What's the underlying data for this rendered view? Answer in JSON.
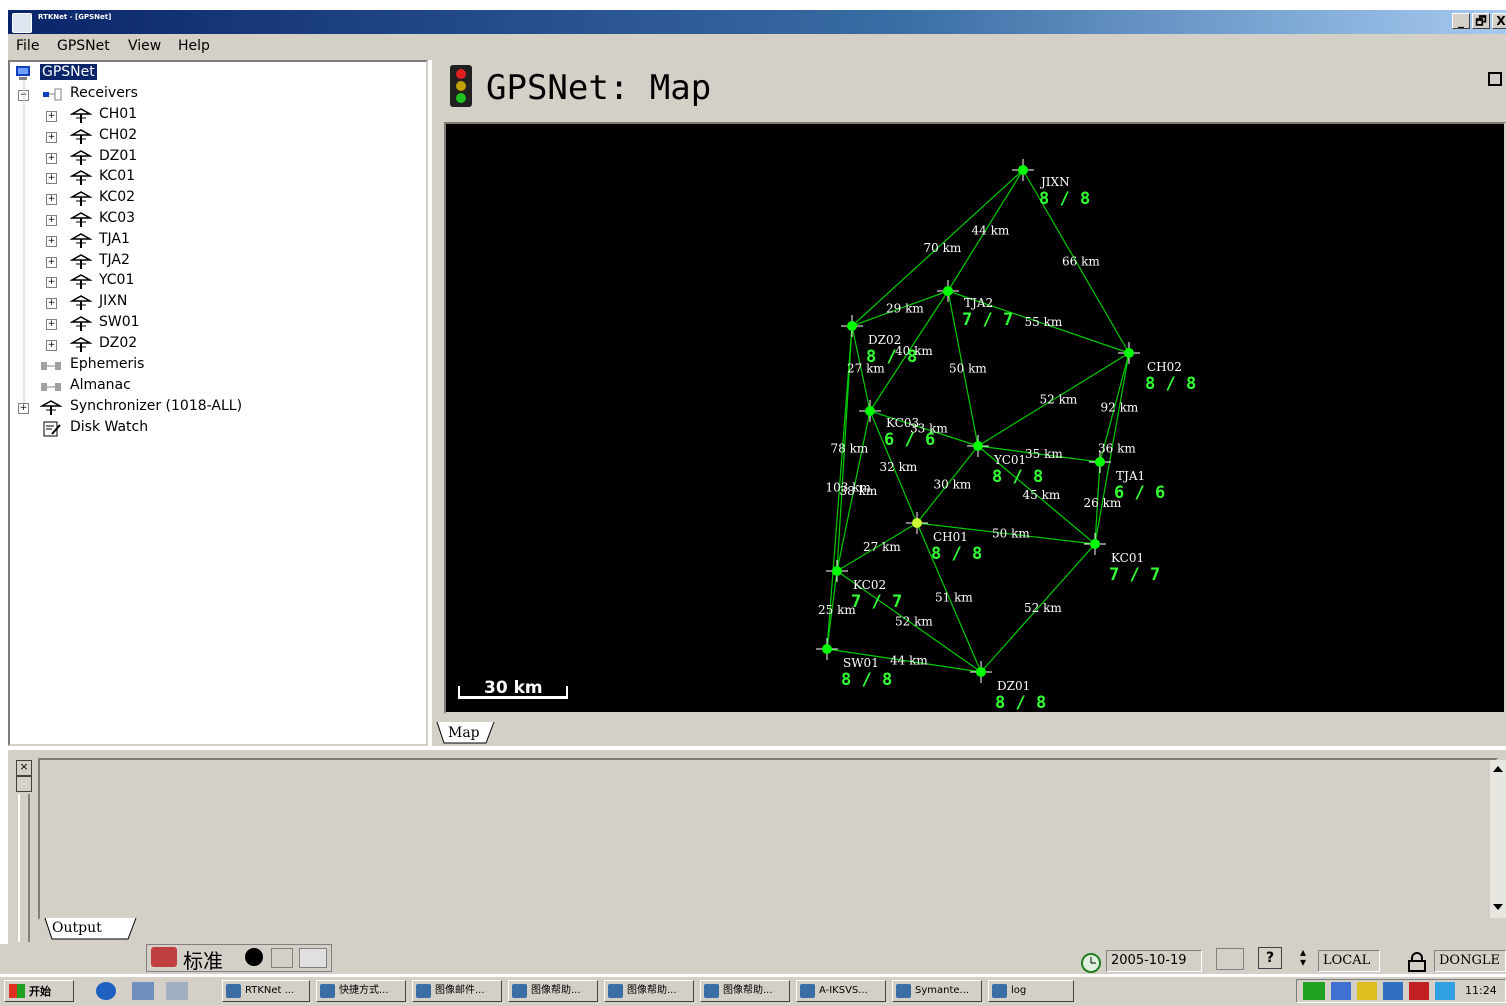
{
  "window": {
    "title": "RTKNet - [GPSNet]",
    "minimize": "_",
    "restore": "🗗",
    "close": "X"
  },
  "menu": [
    "File",
    "GPSNet",
    "View",
    "Help"
  ],
  "tree": {
    "root": "GPSNet",
    "receivers_label": "Receivers",
    "receivers": [
      "CH01",
      "CH02",
      "DZ01",
      "KC01",
      "KC02",
      "KC03",
      "TJA1",
      "TJA2",
      "YC01",
      "JIXN",
      "SW01",
      "DZ02"
    ],
    "others": [
      "Ephemeris",
      "Almanac",
      "Synchronizer (1018-ALL)",
      "Disk Watch"
    ]
  },
  "map": {
    "title": "GPSNet: Map",
    "tab": "Map",
    "scale_label": "30 km",
    "stations": [
      {
        "id": "JIXN",
        "ratio": "8 / 8",
        "status": "green"
      },
      {
        "id": "TJA2",
        "ratio": "7 / 7",
        "status": "green"
      },
      {
        "id": "DZ02",
        "ratio": "8 / 8",
        "status": "green"
      },
      {
        "id": "CH02",
        "ratio": "8 / 8",
        "status": "green"
      },
      {
        "id": "KC03",
        "ratio": "6 / 6",
        "status": "green"
      },
      {
        "id": "YC01",
        "ratio": "8 / 8",
        "status": "green"
      },
      {
        "id": "TJA1",
        "ratio": "6 / 6",
        "status": "green"
      },
      {
        "id": "CH01",
        "ratio": "8 / 8",
        "status": "yellow"
      },
      {
        "id": "KC01",
        "ratio": "7 / 7",
        "status": "green"
      },
      {
        "id": "KC02",
        "ratio": "7 / 7",
        "status": "green"
      },
      {
        "id": "SW01",
        "ratio": "8 / 8",
        "status": "green"
      },
      {
        "id": "DZ01",
        "ratio": "8 / 8",
        "status": "green"
      }
    ],
    "baselines": [
      {
        "from": "DZ02",
        "to": "JIXN",
        "label": "70 km"
      },
      {
        "from": "TJA2",
        "to": "JIXN",
        "label": "44 km"
      },
      {
        "from": "JIXN",
        "to": "CH02",
        "label": "66 km"
      },
      {
        "from": "DZ02",
        "to": "TJA2",
        "label": "29 km"
      },
      {
        "from": "TJA2",
        "to": "CH02",
        "label": "55 km"
      },
      {
        "from": "KC03",
        "to": "TJA2",
        "label": "40 km"
      },
      {
        "from": "DZ02",
        "to": "KC03",
        "label": "27 km"
      },
      {
        "from": "TJA2",
        "to": "YC01",
        "label": "50 km"
      },
      {
        "from": "YC01",
        "to": "CH02",
        "label": "52 km"
      },
      {
        "from": "CH02",
        "to": "KC01",
        "label": "36 km"
      },
      {
        "from": "CH02",
        "to": "TJA1",
        "label": "92 km"
      },
      {
        "from": "KC03",
        "to": "YC01",
        "label": "33 km"
      },
      {
        "from": "DZ02",
        "to": "KC02",
        "label": "78 km"
      },
      {
        "from": "KC03",
        "to": "KC02",
        "label": "38 km"
      },
      {
        "from": "YC01",
        "to": "TJA1",
        "label": "35 km"
      },
      {
        "from": "DZ02",
        "to": "SW01",
        "label": "103 km"
      },
      {
        "from": "KC03",
        "to": "CH01",
        "label": "32 km"
      },
      {
        "from": "YC01",
        "to": "CH01",
        "label": "30 km"
      },
      {
        "from": "YC01",
        "to": "KC01",
        "label": "45 km"
      },
      {
        "from": "TJA1",
        "to": "KC01",
        "label": "26 km"
      },
      {
        "from": "CH01",
        "to": "KC01",
        "label": "50 km"
      },
      {
        "from": "KC02",
        "to": "CH01",
        "label": "27 km"
      },
      {
        "from": "KC02",
        "to": "SW01",
        "label": "25 km"
      },
      {
        "from": "CH01",
        "to": "DZ01",
        "label": "51 km"
      },
      {
        "from": "KC02",
        "to": "DZ01",
        "label": "52 km"
      },
      {
        "from": "KC01",
        "to": "DZ01",
        "label": "52 km"
      },
      {
        "from": "SW01",
        "to": "DZ01",
        "label": "44 km"
      }
    ]
  },
  "output": {
    "tab": "Output"
  },
  "status": {
    "ime": "标准",
    "date": "2005-10-19",
    "mode": "LOCAL",
    "dongle": "DONGLE",
    "time": "11:24"
  },
  "taskbar": {
    "start": "开始",
    "tasks": [
      "RTKNet ...",
      "快捷方式...",
      "图像邮件...",
      "图像帮助...",
      "图像帮助...",
      "图像帮助...",
      "A-IKSVS...",
      "Symante...",
      "log"
    ]
  },
  "colors": {
    "map_bg": "#000000",
    "line": "#00cc00",
    "node": "#00ff00",
    "node_warn": "#ccff33",
    "label": "#ffffff",
    "ratio": "#33ff33"
  }
}
